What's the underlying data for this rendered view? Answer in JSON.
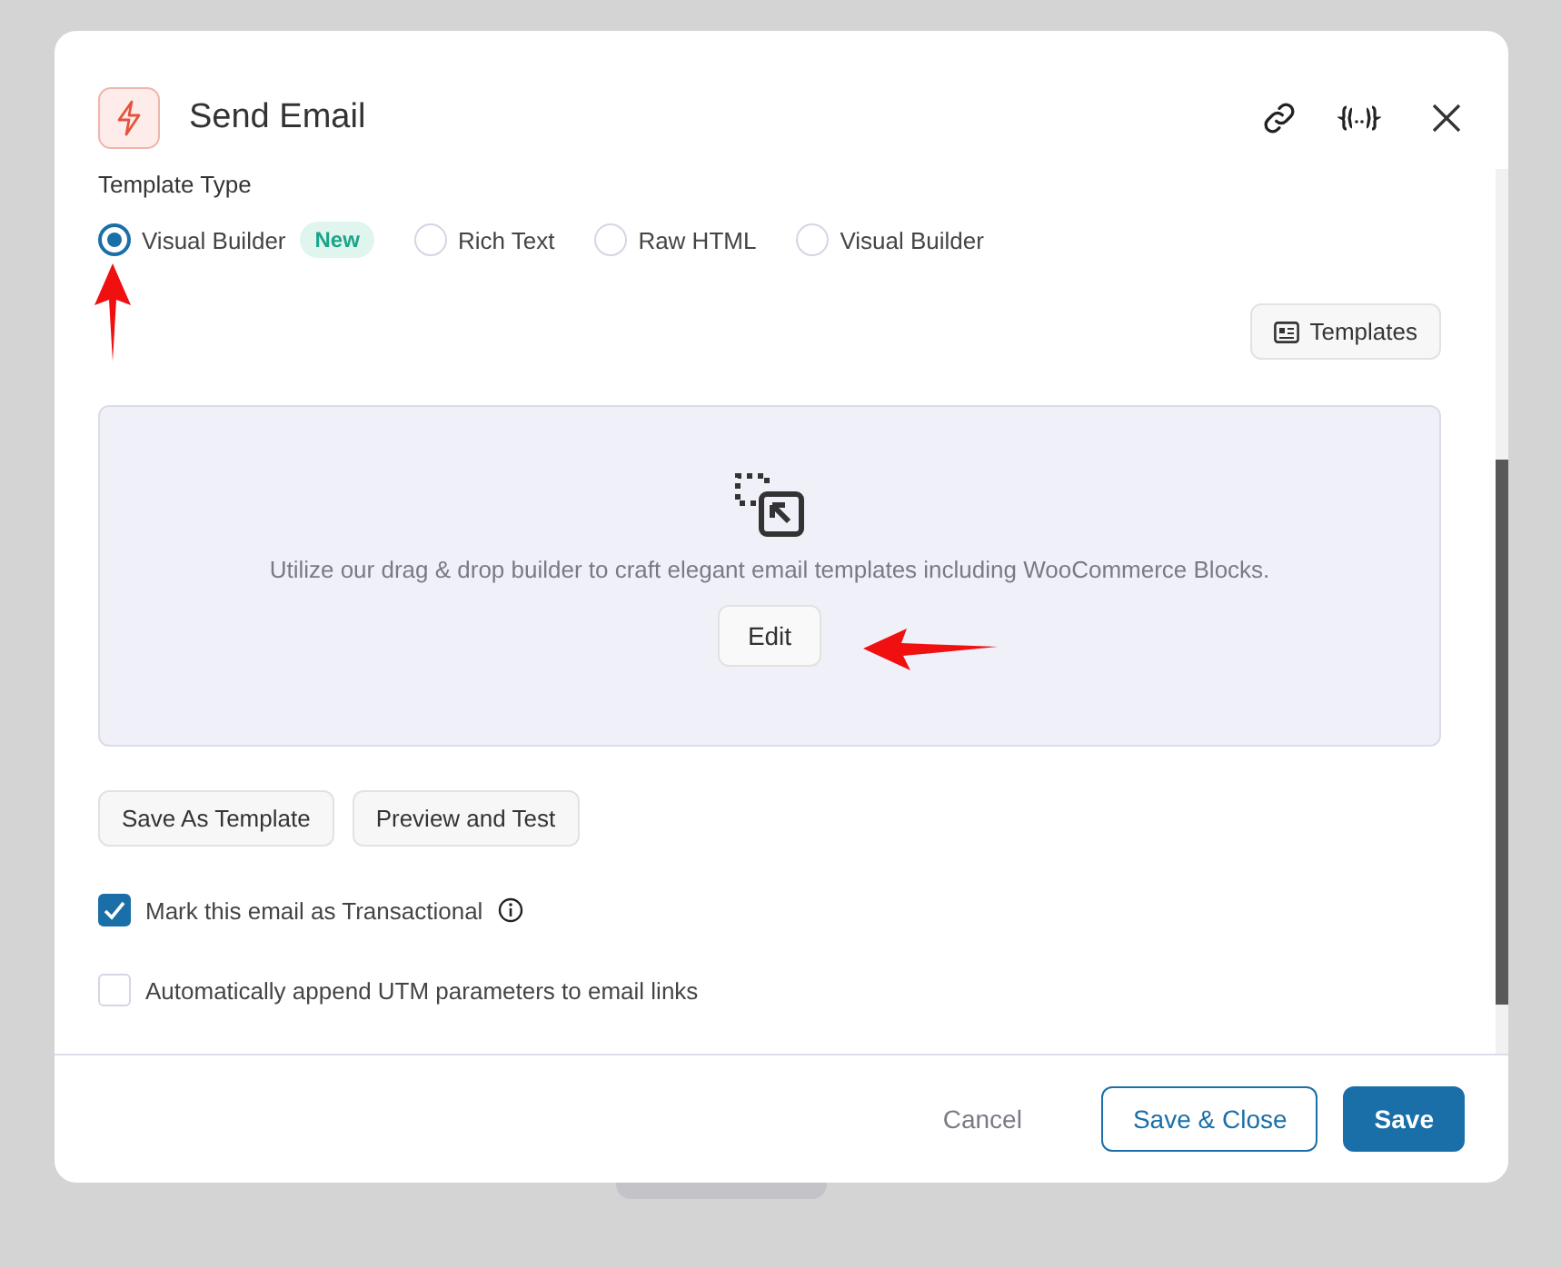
{
  "modal": {
    "title": "Send Email"
  },
  "template_type": {
    "label": "Template Type",
    "options": [
      {
        "label": "Visual Builder",
        "selected": true,
        "badge": "New"
      },
      {
        "label": "Rich Text",
        "selected": false
      },
      {
        "label": "Raw HTML",
        "selected": false
      },
      {
        "label": "Visual Builder",
        "selected": false
      }
    ]
  },
  "templates_button": "Templates",
  "builder": {
    "description": "Utilize our drag & drop builder to craft elegant email templates including WooCommerce Blocks.",
    "button": "Edit"
  },
  "actions": [
    "Save As Template",
    "Preview and Test"
  ],
  "options": [
    {
      "label": "Mark this email as Transactional",
      "checked": true,
      "info": true
    },
    {
      "label": "Automatically append UTM parameters to email links",
      "checked": false,
      "info": false
    }
  ],
  "footer": {
    "cancel": "Cancel",
    "save_close": "Save & Close",
    "save": "Save"
  }
}
